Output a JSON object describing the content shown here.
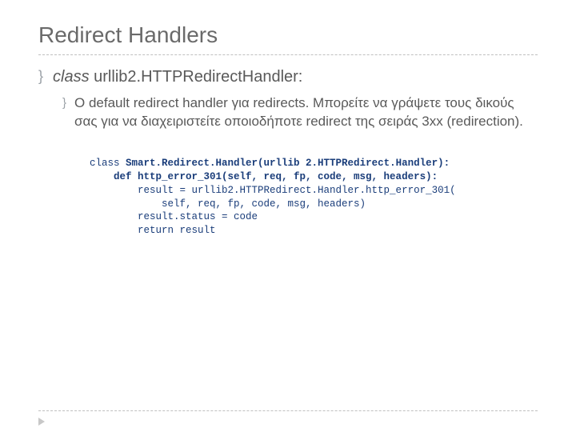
{
  "title": "Redirect Handlers",
  "level1": {
    "class_word": "class",
    "rest": " urllib2.HTTPRedirectHandler:"
  },
  "level2": "Ο default redirect handler για redirects.  Μπορείτε να γράψετε τους δικούς σας για να διαχειριστείτε οποιοδήποτε redirect της σειράς 3xx (redirection).",
  "code": {
    "l1a": "class ",
    "l1b": "Smart.Redirect.Handler(urllib 2.HTTPRedirect.Handler):",
    "l2": "    def http_error_301(self, req, fp, code, msg, headers):",
    "l3": "        result = urllib2.HTTPRedirect.Handler.http_error_301(",
    "l4": "            self, req, fp, code, msg, headers)",
    "l5": "        result.status = code",
    "l6": "        return result"
  }
}
